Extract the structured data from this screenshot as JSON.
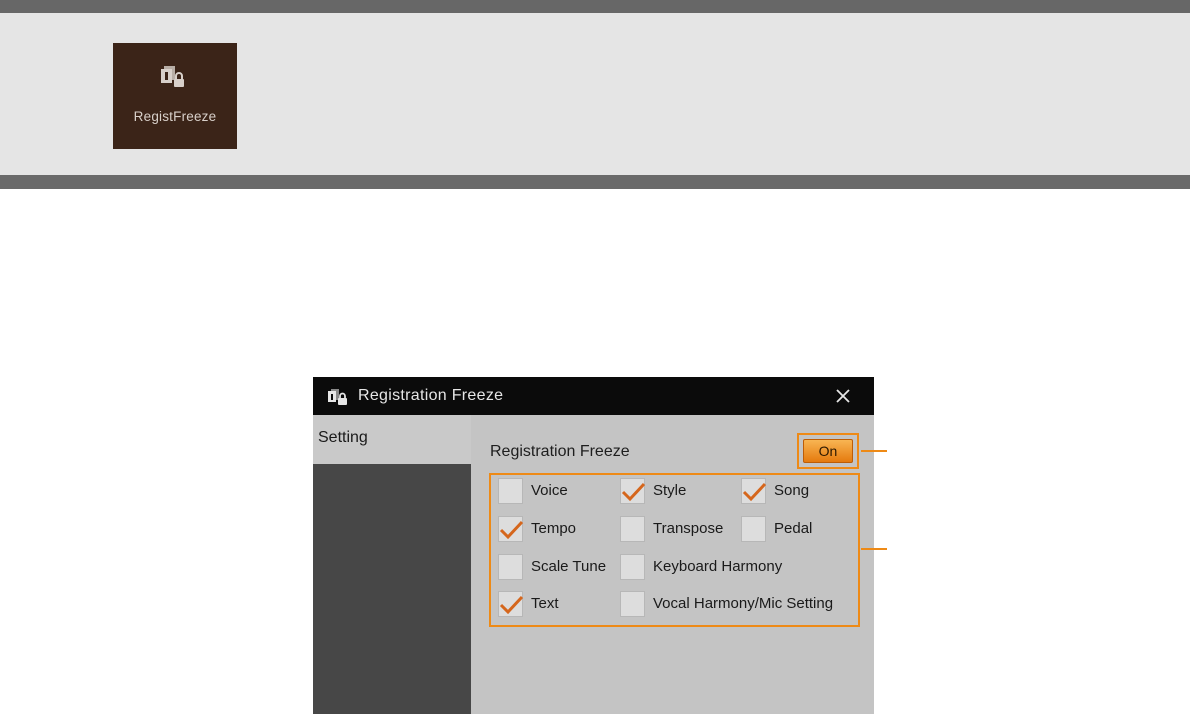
{
  "app_tile": {
    "label": "RegistFreeze",
    "icon": "registration-lock-icon"
  },
  "window": {
    "title": "Registration Freeze",
    "title_icon": "registration-lock-icon",
    "close_icon": "close-icon"
  },
  "sidebar": {
    "tabs": [
      {
        "label": "Setting",
        "selected": true
      }
    ]
  },
  "main": {
    "freeze_label": "Registration Freeze",
    "toggle": {
      "label": "On",
      "state": "on"
    }
  },
  "checkboxes": [
    {
      "label": "Voice",
      "checked": false
    },
    {
      "label": "Style",
      "checked": true
    },
    {
      "label": "Song",
      "checked": true
    },
    {
      "label": "Tempo",
      "checked": true
    },
    {
      "label": "Transpose",
      "checked": false
    },
    {
      "label": "Pedal",
      "checked": false
    },
    {
      "label": "Scale Tune",
      "checked": false
    },
    {
      "label": "Keyboard Harmony",
      "checked": false
    },
    {
      "label": "Text",
      "checked": true
    },
    {
      "label": "Vocal Harmony/Mic Setting",
      "checked": false
    }
  ],
  "colors": {
    "highlight_orange": "#ee8a16",
    "check_mark": "#d5661c",
    "tile_background": "#3b2418",
    "title_bar": "#0b0b0b"
  }
}
